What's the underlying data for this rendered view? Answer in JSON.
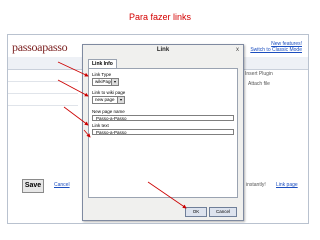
{
  "slide": {
    "title": "Para fazer links"
  },
  "background": {
    "logo": "passoapasso",
    "new_features": "New features!",
    "switch_mode": "Switch to Classic Mode",
    "insert_plugin": "Insert Plugin",
    "attach_file": "Attach file",
    "save": "Save",
    "cancel": "Cancel",
    "link_page": "Link page",
    "status_text": "instantly!"
  },
  "dialog": {
    "title": "Link",
    "close": "x",
    "tab": "Link Info",
    "link_type_label": "Link Type",
    "link_type_value": "wikiPage",
    "link_to_label": "Link to wiki page",
    "link_to_value": "new page",
    "new_page_name_label": "New page name",
    "new_page_name_value": "Passo-a-Passo",
    "link_text_label": "Link text",
    "link_text_value": "Passo-a-Passo",
    "ok": "OK",
    "cancel": "Cancel"
  },
  "colors": {
    "title_red": "#d40000",
    "arrow_red": "#cc0000",
    "link_blue": "#1a4dbf"
  }
}
